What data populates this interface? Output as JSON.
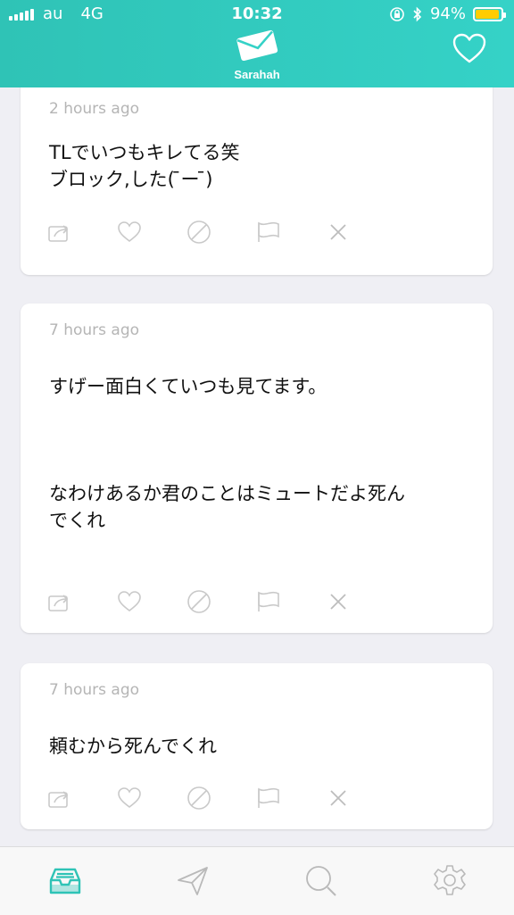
{
  "status_bar": {
    "carrier": "au",
    "network": "4G",
    "time": "10:32",
    "battery": "94%"
  },
  "header": {
    "app_name": "Sarahah",
    "icons": [
      "envelope-logo-icon",
      "heart-outline-icon"
    ]
  },
  "colors": {
    "header": "#35d2c7",
    "accent": "#2fc3b6",
    "battery_fill": "#ffcc00",
    "icon_gray": "#c9c9c9"
  },
  "messages": [
    {
      "time": "2 hours ago",
      "text": "TLでいつもキレてる笑\nブロック,した( ̄ー ̄)"
    },
    {
      "time": "7 hours ago",
      "text": "すげー面白くていつも見てます。\n\n\n\nなわけあるか君のことはミュートだよ死ん\nでくれ"
    },
    {
      "time": "7 hours ago",
      "text": "頼むから死んでくれ"
    }
  ],
  "message_actions": [
    "share-icon",
    "heart-icon",
    "block-icon",
    "flag-icon",
    "delete-icon"
  ],
  "tabbar": {
    "tabs": [
      "inbox-icon",
      "send-icon",
      "search-icon",
      "settings-icon"
    ],
    "active": "inbox-icon"
  }
}
